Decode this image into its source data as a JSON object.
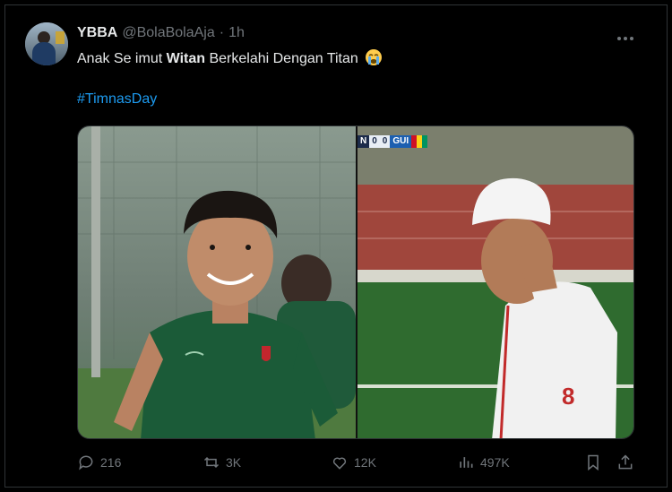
{
  "tweet": {
    "display_name": "YBBA",
    "handle": "@BolaBolaAja",
    "separator": "·",
    "time": "1h",
    "text_part1": "Anak Se imut ",
    "text_bold": "Witan",
    "text_part2": " Berkelahi Dengan Titan",
    "hashtag": "#TimnasDay"
  },
  "media": {
    "scoreboard": {
      "left_team": "N",
      "left_score": "0",
      "right_score": "0",
      "right_team": "GUI"
    }
  },
  "actions": {
    "replies": "216",
    "reposts": "3K",
    "likes": "12K",
    "views": "497K"
  },
  "colors": {
    "background": "#000000",
    "text": "#e7e9ea",
    "muted": "#71767b",
    "accent": "#1d9bf0"
  },
  "icons": [
    "more-icon",
    "crying-face-emoji",
    "reply-icon",
    "repost-icon",
    "like-icon",
    "views-icon",
    "bookmark-icon",
    "share-icon"
  ]
}
